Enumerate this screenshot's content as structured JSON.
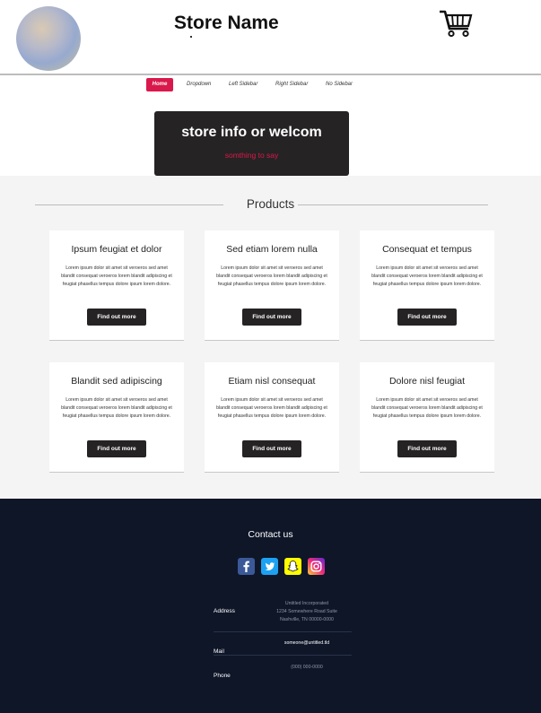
{
  "header": {
    "store_name": "Store Name"
  },
  "nav": {
    "items": [
      "Home",
      "Dropdown",
      "Left Sidebar",
      "Right Sidebar",
      "No Sidebar"
    ]
  },
  "hero": {
    "title": "store info or welcom",
    "subtitle": "somthing to say"
  },
  "products": {
    "heading": "Products",
    "button_label": "Find out more",
    "description": "Lorem ipsum dolor sit amet sit veroeros sed amet blandit consequat veroeros lorem blandit adipiscing et feugiat phasellus tempus dolore ipsum lorem dolore.",
    "cards": [
      {
        "title": "Ipsum feugiat et dolor"
      },
      {
        "title": "Sed etiam lorem nulla"
      },
      {
        "title": "Consequat et tempus"
      },
      {
        "title": "Blandit sed adipiscing"
      },
      {
        "title": "Etiam nisl consequat"
      },
      {
        "title": "Dolore nisl feugiat"
      }
    ]
  },
  "footer": {
    "contact_title": "Contact us",
    "social": [
      "facebook-icon",
      "twitter-icon",
      "snapchat-icon",
      "instagram-icon"
    ],
    "address_label": "Address",
    "address_lines": [
      "Untitled Incorporated",
      "1234 Somewhere Road Suite",
      "Nashville, TN 00000-0000"
    ],
    "mail_label": "Mail",
    "mail_value": "someone@untitled.tld",
    "phone_label": "Phone",
    "phone_value": "(000) 000-0000"
  },
  "colors": {
    "accent": "#d9194b",
    "dark": "#262324",
    "footer_bg": "#0e1628"
  }
}
